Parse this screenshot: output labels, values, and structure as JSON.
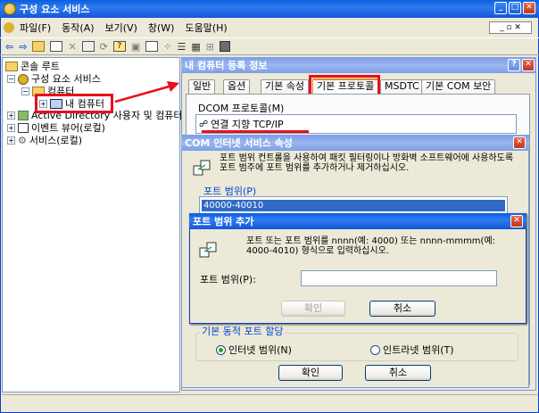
{
  "main_window": {
    "title": "구성 요소 서비스",
    "menu": [
      "파일(F)",
      "동작(A)",
      "보기(V)",
      "창(W)",
      "도움말(H)"
    ]
  },
  "tree": {
    "console_root": "콘솔 루트",
    "component_services": "구성 요소 서비스",
    "computers": "컴퓨터",
    "my_computer": "내 컴퓨터",
    "active_directory": "Active Directory 사용자 및 컴퓨터",
    "event_viewer": "이벤트 뷰어(로컬)",
    "services": "서비스(로컬)"
  },
  "props_dialog": {
    "title": "내 컴퓨터 등록 정보",
    "tabs": [
      "일반",
      "옵션",
      "기본 속성",
      "기본 프로토콜",
      "MSDTC",
      "기본 COM 보안"
    ],
    "dcom_label": "DCOM 프로토콜(M)",
    "dcom_item": "연결 지향 TCP/IP"
  },
  "com_dialog": {
    "title": "COM 인터넷 서비스 속성",
    "description": "포트 범위 컨트롤을 사용하여 패킷 필터링이나 방화벽 소프트웨어에 사용하도록 포트 범주에 포트 범위를 추가하거나 제거하십시오.",
    "port_range_label": "포트 범위(P)",
    "port_range_item": "40000-40010",
    "dynamic_group": "기본 동적 포트 할당",
    "radio_internet": "인터넷 범위(N)",
    "radio_intranet": "인트라넷 범위(T)",
    "ok": "확인",
    "cancel": "취소"
  },
  "add_dialog": {
    "title": "포트 범위 추가",
    "description": "포트 또는 포트 범위를 nnnn(예: 4000) 또는 nnnn-mmmm(예: 4000-4010) 형식으로 입력하십시오.",
    "field_label": "포트 범위(P):",
    "field_value": "",
    "ok": "확인",
    "cancel": "취소"
  }
}
